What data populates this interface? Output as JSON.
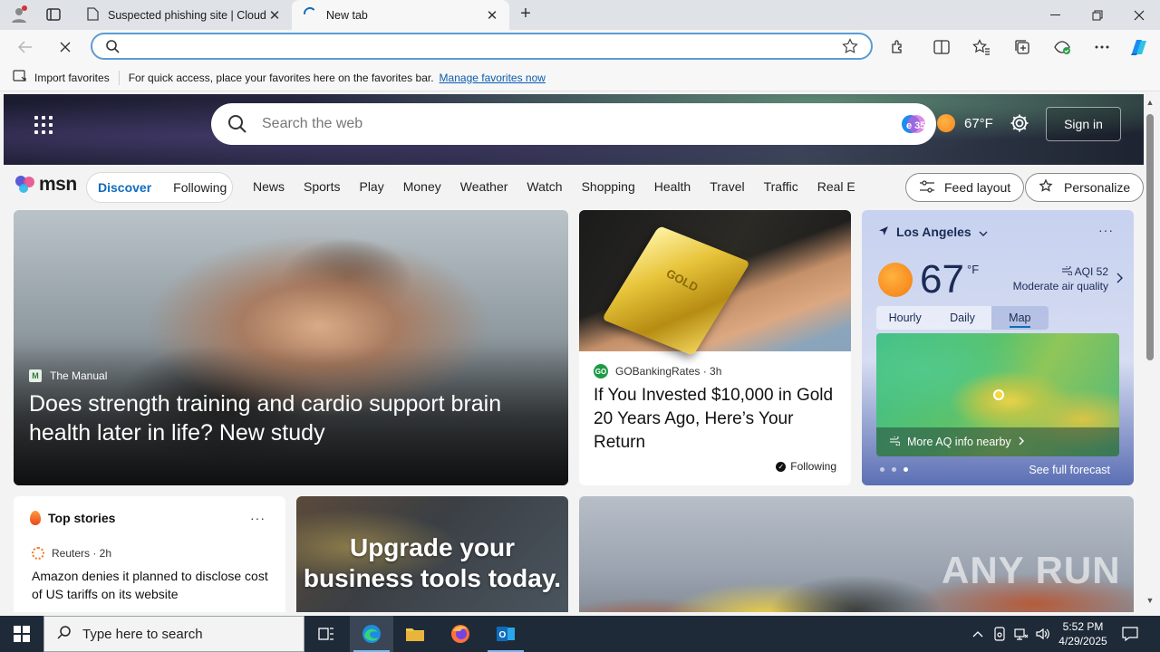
{
  "browser": {
    "tabs": [
      {
        "title": "Suspected phishing site | Cloudfl",
        "active": false
      },
      {
        "title": "New tab",
        "active": true
      }
    ],
    "address": {
      "value": "",
      "placeholder": ""
    },
    "favorites_bar": {
      "import_label": "Import favorites",
      "message": "For quick access, place your favorites here on the favorites bar.",
      "link": "Manage favorites now"
    }
  },
  "msn": {
    "search_placeholder": "Search the web",
    "copilot_label": "e 35",
    "hero_weather_temp": "67°F",
    "sign_in": "Sign in",
    "logo": "msn",
    "segments": [
      "Discover",
      "Following"
    ],
    "categories": [
      "News",
      "Sports",
      "Play",
      "Money",
      "Weather",
      "Watch",
      "Shopping",
      "Health",
      "Travel",
      "Traffic",
      "Real E"
    ],
    "feed_layout": "Feed layout",
    "personalize": "Personalize"
  },
  "hero_card": {
    "source": "The Manual",
    "headline": "Does strength training and cardio support brain health later in life? New study"
  },
  "gold_card": {
    "image_label": "GOLD",
    "source": "GOBankingRates · 3h",
    "source_logo": "GO",
    "headline": "If You Invested $10,000 in Gold 20 Years Ago, Here’s Your Return",
    "following": "Following"
  },
  "weather_card": {
    "location": "Los Angeles",
    "temp": "67",
    "unit": "°F",
    "aqi": "AQI 52",
    "aqi_desc": "Moderate air quality",
    "tabs": [
      "Hourly",
      "Daily",
      "Map"
    ],
    "active_tab": "Map",
    "more_aq": "More AQ info nearby",
    "forecast": "See full forecast"
  },
  "top_stories": {
    "title": "Top stories",
    "source": "Reuters · 2h",
    "headline": "Amazon denies it planned to disclose cost of US tariffs on its website"
  },
  "ad_card": {
    "text": "Upgrade your business tools today."
  },
  "watermark": "ANY RUN",
  "taskbar": {
    "search_placeholder": "Type here to search",
    "time": "5:52 PM",
    "date": "4/29/2025"
  },
  "colors": {
    "accent": "#0f6cbd",
    "taskbar": "#1f2a38"
  }
}
